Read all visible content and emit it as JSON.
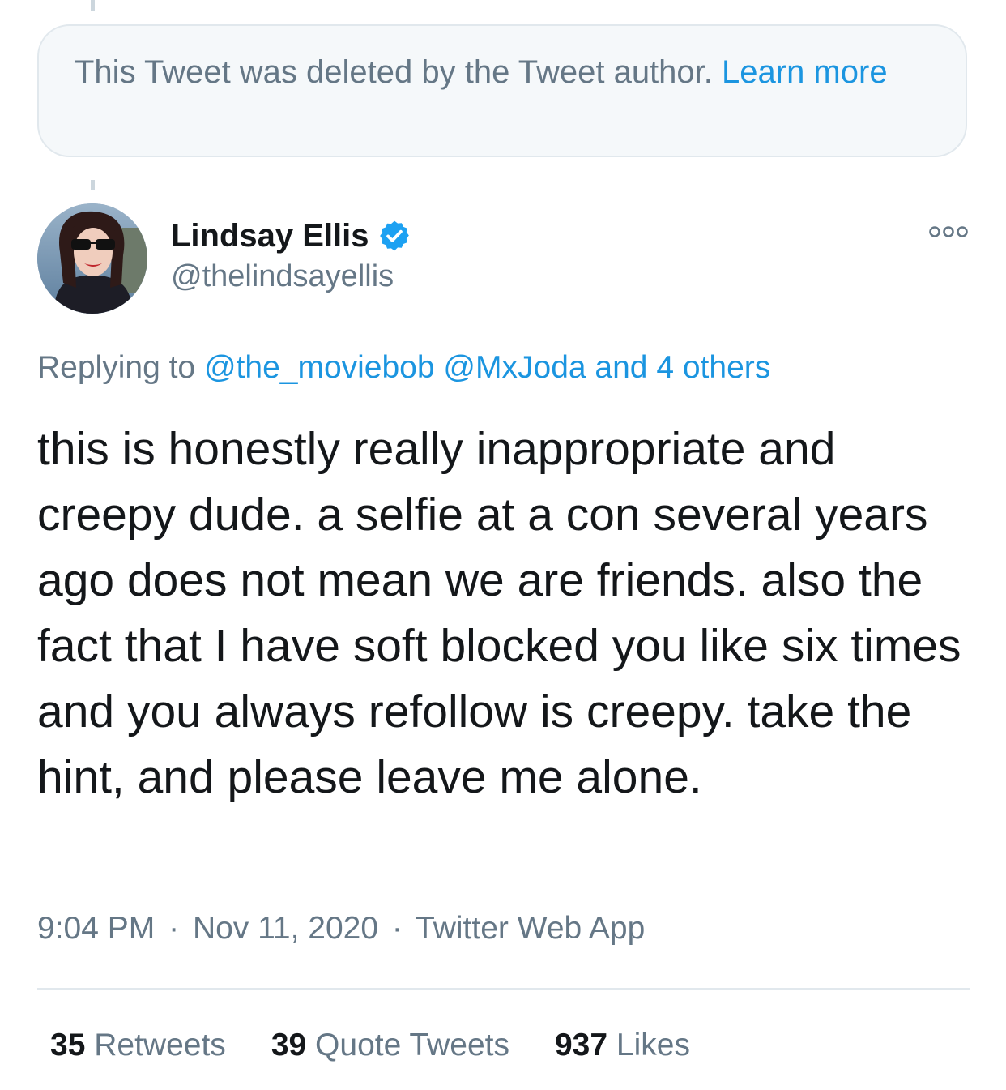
{
  "deleted_notice": {
    "text": "This Tweet was deleted by the Tweet author.",
    "learn_more": "Learn more"
  },
  "author": {
    "name": "Lindsay Ellis",
    "handle": "@thelindsayellis",
    "verified": true
  },
  "reply_context": {
    "prefix": "Replying to",
    "mention_1": "@the_moviebob",
    "mention_2": "@MxJoda",
    "others": "and 4 others"
  },
  "tweet": {
    "text": "this is honestly really inappropriate and creepy dude. a selfie at a con several years ago does not mean we are friends. also the fact that I have soft blocked you like six times and you always refollow is creepy. take the hint, and please leave me alone."
  },
  "meta": {
    "time": "9:04 PM",
    "date": "Nov 11, 2020",
    "source": "Twitter Web App",
    "separator": "·"
  },
  "stats": {
    "retweets_count": "35",
    "retweets_label": "Retweets",
    "quotes_count": "39",
    "quotes_label": "Quote Tweets",
    "likes_count": "937",
    "likes_label": "Likes"
  },
  "colors": {
    "link": "#1b95e0",
    "secondary_text": "#657786",
    "verified_badge": "#1da1f2"
  },
  "icons": {
    "verified": "verified-badge-icon",
    "more": "more-options-icon"
  }
}
